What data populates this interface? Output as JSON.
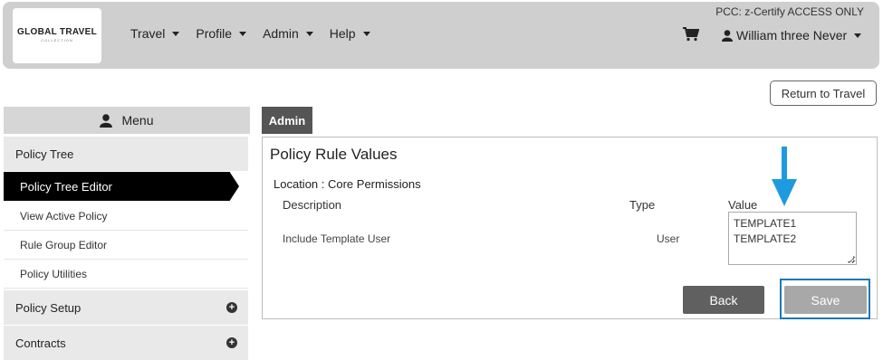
{
  "header": {
    "logo_line1": "GLOBAL TRAVEL",
    "logo_line2": "COLLECTION",
    "nav": [
      "Travel",
      "Profile",
      "Admin",
      "Help"
    ],
    "pcc": "PCC: z-Certify ACCESS ONLY",
    "user": "William three Never",
    "cart_icon": "shopping-cart-icon",
    "user_icon": "person-icon"
  },
  "return_button": "Return to Travel",
  "sidebar": {
    "title": "Menu",
    "sections": {
      "policy_tree": "Policy Tree",
      "policy_setup": "Policy Setup",
      "contracts": "Contracts"
    },
    "items": [
      "Policy Tree Editor",
      "View Active Policy",
      "Rule Group Editor",
      "Policy Utilities"
    ]
  },
  "main": {
    "tab": "Admin",
    "title": "Policy Rule Values",
    "location": "Location : Core Permissions",
    "columns": {
      "description": "Description",
      "type": "Type",
      "value": "Value"
    },
    "row": {
      "description": "Include Template User",
      "type": "User",
      "value_lines": [
        "TEMPLATE1",
        "TEMPLATE2"
      ]
    },
    "back_label": "Back",
    "save_label": "Save"
  },
  "colors": {
    "highlight": "#1b78b8",
    "arrow": "#1e9be0"
  }
}
